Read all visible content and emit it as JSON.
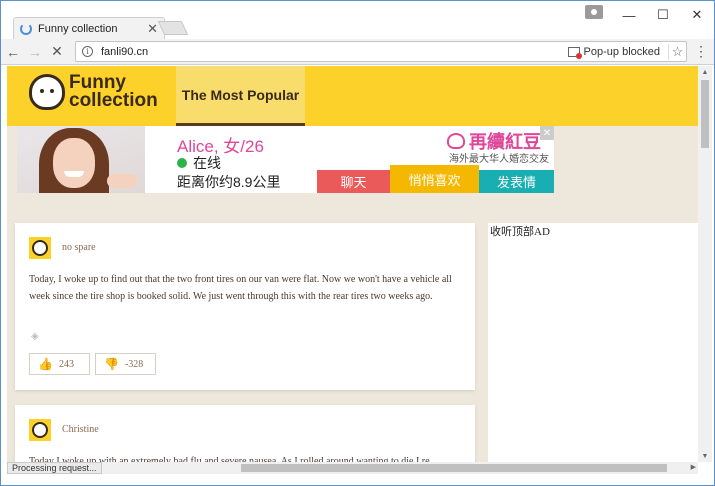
{
  "browser": {
    "tab_title": "Funny collection",
    "tab_close": "✕",
    "url": "fanli90.cn",
    "popup_blocked": "Pop-up blocked",
    "status": "Processing request...",
    "window_controls": {
      "minimize": "—",
      "maximize": "☐",
      "close": "✕"
    },
    "nav": {
      "back": "←",
      "forward": "→",
      "stop": "✕",
      "star": "☆",
      "menu": "⋮"
    }
  },
  "site": {
    "logo_line1": "Funny",
    "logo_line2": "collection",
    "nav_popular": "The Most Popular"
  },
  "ad": {
    "name": "Alice, 女/26",
    "online": "在线",
    "distance": "距离你约8.9公里",
    "brand": "再續紅豆",
    "tagline": "海外最大华人婚恋交友",
    "close": "✕",
    "btn_chat": "聊天",
    "btn_whisper": "悄悄喜欢",
    "btn_emoji": "发表情"
  },
  "posts": [
    {
      "author": "no spare",
      "text": "Today, I woke up to find out that the two front tires on our van were flat. Now we won't have a vehicle all week since the tire shop is booked solid. We just went through this with the rear tires two weeks ago.",
      "upvotes": "243",
      "downvotes": "-328"
    },
    {
      "author": "Christine",
      "text": "Today I woke up with an extremely bad flu and severe nausea. As I rolled around wanting to die I re..."
    }
  ],
  "sidebar": {
    "label": "收听顶部AD"
  },
  "colors": {
    "header_yellow": "#fcd12a",
    "page_bg": "#eee8dc",
    "ad_pink": "#e0469a",
    "btn_red": "#ea5a5a",
    "btn_orange": "#f5b800",
    "btn_teal": "#19aeb1"
  }
}
